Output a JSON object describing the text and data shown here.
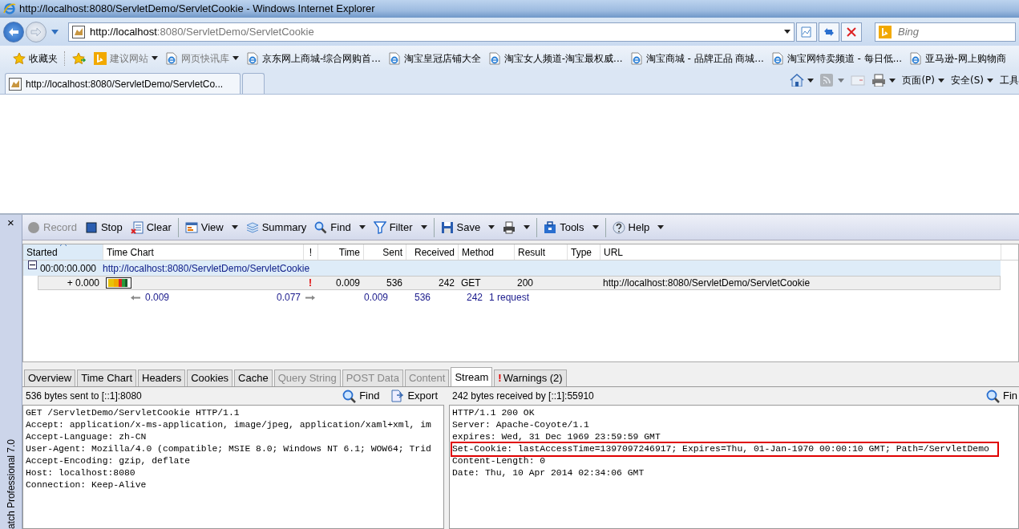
{
  "window": {
    "title": "http://localhost:8080/ServletDemo/ServletCookie - Windows Internet Explorer"
  },
  "address_bar": {
    "url_host": "http://localhost",
    "url_rest": ":8080/ServletDemo/ServletCookie"
  },
  "search": {
    "placeholder": "Bing"
  },
  "favorites_bar": {
    "label": "收藏夹",
    "items": [
      {
        "label": "建议网站",
        "dropdown": true,
        "disabled": true
      },
      {
        "label": "网页快讯库",
        "dropdown": true,
        "disabled": true
      },
      {
        "label": "京东网上商城-综合网购首...",
        "dropdown": false,
        "disabled": false
      },
      {
        "label": "淘宝皇冠店铺大全",
        "dropdown": false,
        "disabled": false
      },
      {
        "label": "淘宝女人频道-淘宝最权威...",
        "dropdown": false,
        "disabled": false
      },
      {
        "label": "淘宝商城 - 品牌正品 商城...",
        "dropdown": false,
        "disabled": false
      },
      {
        "label": "淘宝网特卖频道 - 每日低...",
        "dropdown": false,
        "disabled": false
      },
      {
        "label": "亚马逊-网上购物商",
        "dropdown": false,
        "disabled": false
      }
    ]
  },
  "browser_tabs": [
    {
      "label": "http://localhost:8080/ServletDemo/ServletCo...",
      "selected": true
    },
    {
      "selected": false
    }
  ],
  "command_bar": [
    {
      "kind": "home",
      "dropdown": true,
      "disabled": false
    },
    {
      "kind": "feeds",
      "dropdown": true,
      "disabled": true
    },
    {
      "kind": "mail",
      "dropdown": false,
      "disabled": true
    },
    {
      "kind": "print",
      "dropdown": true,
      "disabled": false
    },
    {
      "kind": "menu",
      "label": "页面(P)",
      "dropdown": true,
      "disabled": false
    },
    {
      "kind": "menu",
      "label": "安全(S)",
      "dropdown": true,
      "disabled": false
    },
    {
      "kind": "menu",
      "label": "工具",
      "dropdown": false,
      "disabled": false
    }
  ],
  "httpwatch": {
    "close_label": "×",
    "side_label": "atch Professional 7.0",
    "toolbar": [
      {
        "kind": "button",
        "label": "Record",
        "dropdown": false,
        "disabled": true
      },
      {
        "kind": "button",
        "label": "Stop",
        "dropdown": false,
        "disabled": false
      },
      {
        "kind": "button",
        "label": "Clear",
        "dropdown": false,
        "disabled": false
      },
      {
        "kind": "separator"
      },
      {
        "kind": "button",
        "label": "View",
        "dropdown": true,
        "disabled": false
      },
      {
        "kind": "button",
        "label": "Summary",
        "dropdown": false,
        "disabled": false
      },
      {
        "kind": "button",
        "label": "Find",
        "dropdown": true,
        "disabled": false
      },
      {
        "kind": "button",
        "label": "Filter",
        "dropdown": true,
        "disabled": false
      },
      {
        "kind": "separator"
      },
      {
        "kind": "button",
        "label": "Save",
        "dropdown": true,
        "disabled": false
      },
      {
        "kind": "button",
        "dropdown": true,
        "disabled": false
      },
      {
        "kind": "separator"
      },
      {
        "kind": "button",
        "label": "Tools",
        "dropdown": true,
        "disabled": false
      },
      {
        "kind": "separator"
      },
      {
        "kind": "button",
        "label": "Help",
        "dropdown": true,
        "disabled": false
      }
    ],
    "columns": [
      {
        "label": "Started",
        "sorted": true
      },
      {
        "label": "Time Chart",
        "sorted": false
      },
      {
        "label": "!",
        "sorted": false
      },
      {
        "label": "Time",
        "sorted": false
      },
      {
        "label": "Sent",
        "sorted": false
      },
      {
        "label": "Received",
        "sorted": false
      },
      {
        "label": "Method",
        "sorted": false
      },
      {
        "label": "Result",
        "sorted": false
      },
      {
        "label": "Type",
        "sorted": false
      },
      {
        "label": "URL",
        "sorted": false
      }
    ],
    "rows": [
      {
        "kind": "page",
        "expanded": true,
        "started": "00:00:00.000",
        "title": "http://localhost:8080/ServletDemo/ServletCookie"
      },
      {
        "kind": "request",
        "started": "+ 0.000",
        "warning": "!",
        "time": "0.009",
        "sent": "536",
        "received": "242",
        "method": "GET",
        "result": "200",
        "url": "http://localhost:8080/ServletDemo/ServletCookie"
      },
      {
        "kind": "summary",
        "chart_start": "0.009",
        "chart_end": "0.077",
        "time": "0.009",
        "sent": "536",
        "received": "242",
        "method": "1 request"
      }
    ],
    "detail_tabs": [
      {
        "label": "Overview",
        "selected": false,
        "disabled": false
      },
      {
        "label": "Time Chart",
        "selected": false,
        "disabled": false
      },
      {
        "label": "Headers",
        "selected": false,
        "disabled": false
      },
      {
        "label": "Cookies",
        "selected": false,
        "disabled": false
      },
      {
        "label": "Cache",
        "selected": false,
        "disabled": false
      },
      {
        "label": "Query String",
        "selected": false,
        "disabled": true
      },
      {
        "label": "POST Data",
        "selected": false,
        "disabled": true
      },
      {
        "label": "Content",
        "selected": false,
        "disabled": true
      },
      {
        "label": "Stream",
        "selected": true,
        "disabled": false
      },
      {
        "label": "Warnings (2)",
        "selected": false,
        "disabled": false,
        "warning": "!"
      }
    ],
    "stream_panes": [
      {
        "summary": "536 bytes sent to [::1]:8080",
        "actions": [
          "Find",
          "Export"
        ],
        "lines": [
          {
            "text": "GET /ServletDemo/ServletCookie HTTP/1.1",
            "highlighted": false
          },
          {
            "text": "Accept: application/x-ms-application, image/jpeg, application/xaml+xml, im",
            "highlighted": false
          },
          {
            "text": "Accept-Language: zh-CN",
            "highlighted": false
          },
          {
            "text": "User-Agent: Mozilla/4.0 (compatible; MSIE 8.0; Windows NT 6.1; WOW64; Trid",
            "highlighted": false
          },
          {
            "text": "Accept-Encoding: gzip, deflate",
            "highlighted": false
          },
          {
            "text": "Host: localhost:8080",
            "highlighted": false
          },
          {
            "text": "Connection: Keep-Alive",
            "highlighted": false
          }
        ]
      },
      {
        "summary": "242 bytes received by [::1]:55910",
        "actions": [
          "Fin"
        ],
        "lines": [
          {
            "text": "HTTP/1.1 200 OK",
            "highlighted": false
          },
          {
            "text": "Server: Apache-Coyote/1.1",
            "highlighted": false
          },
          {
            "text": "expires: Wed, 31 Dec 1969 23:59:59 GMT",
            "highlighted": false
          },
          {
            "text": "Set-Cookie: lastAccessTime=1397097246917; Expires=Thu, 01-Jan-1970 00:00:10 GMT; Path=/ServletDemo",
            "highlighted": true
          },
          {
            "text": "Content-Length: 0",
            "highlighted": false
          },
          {
            "text": "Date: Thu, 10 Apr 2014 02:34:06 GMT",
            "highlighted": false
          }
        ]
      }
    ]
  }
}
